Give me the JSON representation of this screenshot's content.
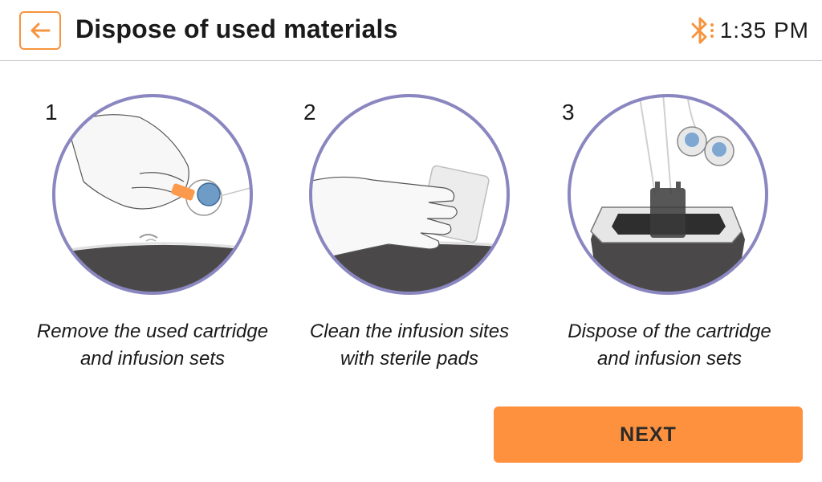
{
  "header": {
    "title": "Dispose of used materials",
    "back_icon": "arrow-left-icon",
    "status_icon": "bluetooth-icon",
    "time": "1:35 PM"
  },
  "steps": [
    {
      "number": "1",
      "caption_line1": "Remove the used cartridge",
      "caption_line2": "and infusion sets",
      "illustration": "hand-removing-cartridge"
    },
    {
      "number": "2",
      "caption_line1": "Clean the infusion sites",
      "caption_line2": "with sterile pads",
      "illustration": "hand-cleaning-with-pad"
    },
    {
      "number": "3",
      "caption_line1": "Dispose of the cartridge",
      "caption_line2": "and infusion sets",
      "illustration": "disposal-container"
    }
  ],
  "footer": {
    "next_label": "NEXT"
  },
  "colors": {
    "accent": "#fd913e",
    "circle_ring": "#8a86c0",
    "divider": "#c8c8c8"
  }
}
